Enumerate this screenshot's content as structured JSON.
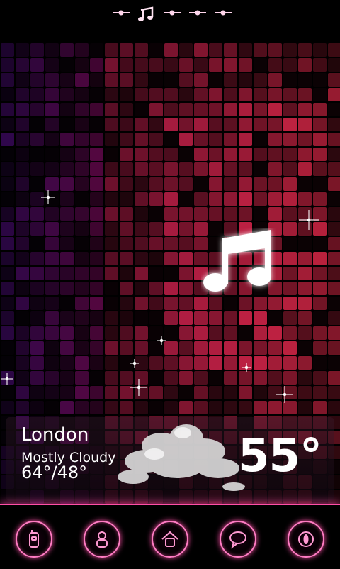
{
  "weather": {
    "city": "London",
    "condition": "Mostly Cloudy",
    "hi_lo": "64°/48°",
    "temperature": "55°"
  },
  "page_indicator": {
    "pages": [
      "dash",
      "music-note",
      "dash",
      "dash",
      "dash"
    ],
    "active_index": 1
  },
  "dock": {
    "items": [
      "phone-icon",
      "contacts-icon",
      "home-icon",
      "messages-icon",
      "app-drawer-icon"
    ]
  },
  "colors": {
    "accent": "#ff4fa8",
    "background": "#000000"
  }
}
